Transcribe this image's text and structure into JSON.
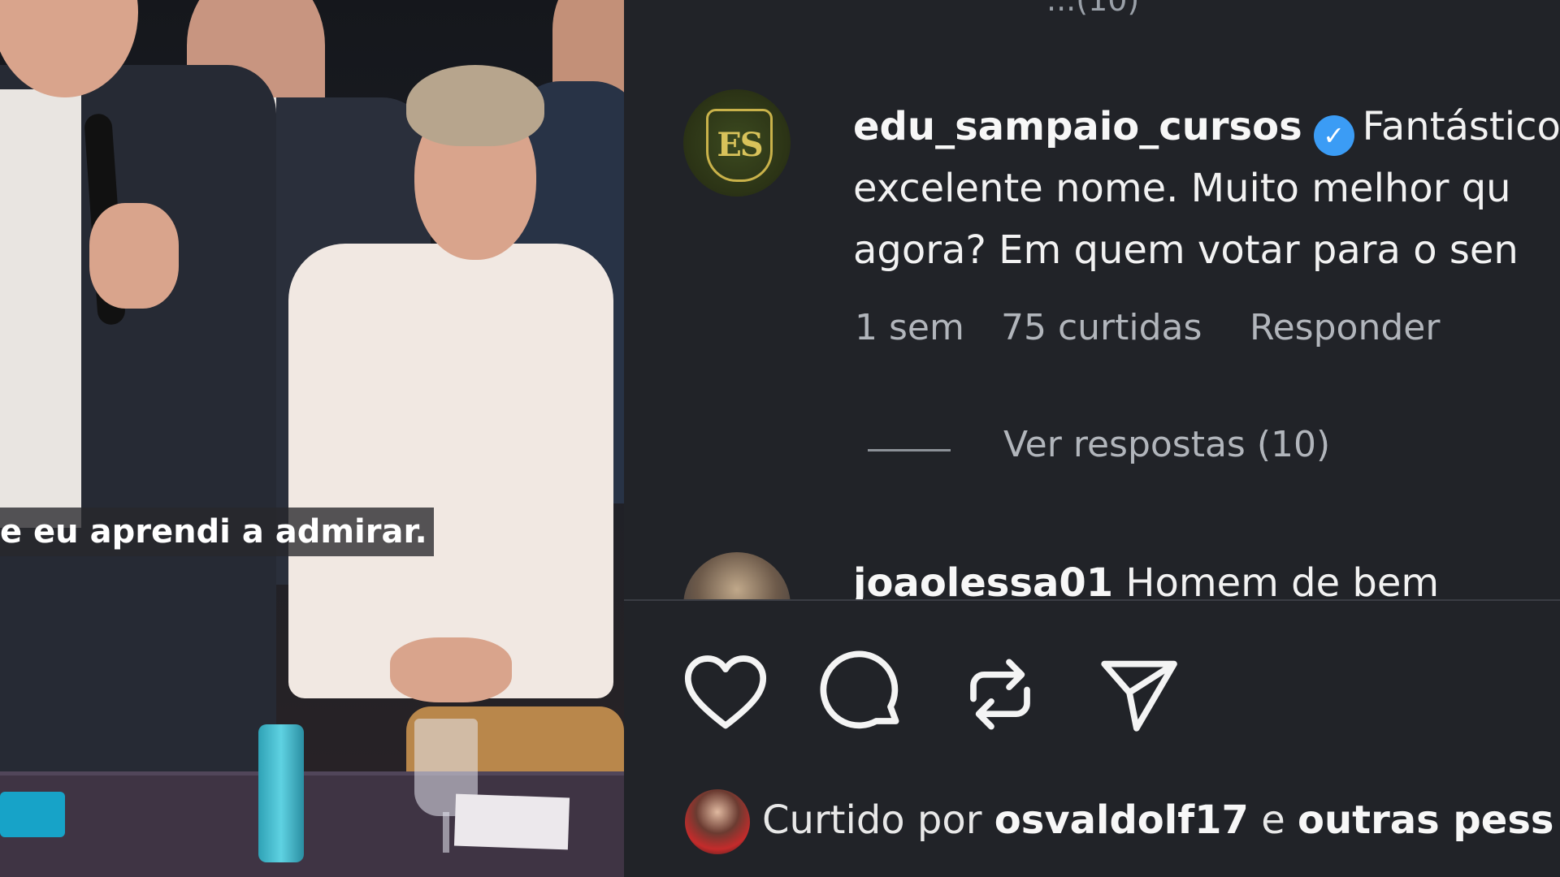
{
  "video": {
    "subtitle": "e eu aprendi a admirar."
  },
  "panel": {
    "top_cutoff_text": "...(10)",
    "comments": [
      {
        "username": "edu_sampaio_cursos",
        "verified": true,
        "avatar_text": "ES",
        "line1": "Fantástico",
        "line2": "excelente nome. Muito melhor qu",
        "line3": "agora? Em quem votar para o sen",
        "time": "1 sem",
        "likes": "75 curtidas",
        "reply": "Responder",
        "view_replies": "Ver respostas (10)"
      },
      {
        "username": "joaolessa01",
        "text": "Homem de bem"
      }
    ],
    "actions": {
      "like_icon": "heart-icon",
      "comment_icon": "comment-icon",
      "repost_icon": "repost-icon",
      "share_icon": "send-icon"
    },
    "liked_by": {
      "prefix": "Curtido por",
      "user": "osvaldolf17",
      "conj": "e",
      "rest": "outras pess"
    }
  },
  "colors": {
    "background": "#212328",
    "verified": "#3b9cf5",
    "muted": "#b1b5bb"
  }
}
